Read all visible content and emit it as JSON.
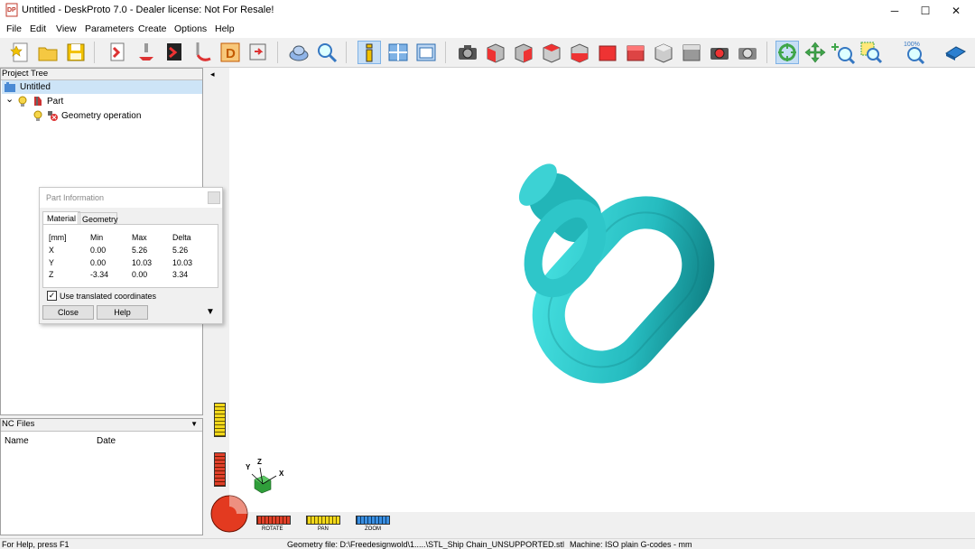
{
  "window": {
    "title": "Untitled - DeskProto 7.0 - Dealer license: Not For Resale!",
    "app_icon_text": "DP",
    "minimize": "─",
    "maximize": "☐",
    "close": "✕"
  },
  "menu": [
    "File",
    "Edit",
    "View",
    "Parameters",
    "Create",
    "Options",
    "Help"
  ],
  "toolbar": {
    "zoom_percent_label": "100%"
  },
  "project_tree": {
    "header": "Project Tree",
    "root": "Untitled",
    "expander": "⌄",
    "part": "Part",
    "geometry_operation": "Geometry operation"
  },
  "nc_files": {
    "header": "NC Files",
    "dropdown": "▼",
    "col_name": "Name",
    "col_date": "Date"
  },
  "viewport": {
    "collapse_arrow": "◂",
    "axis_x": "X",
    "axis_y": "Y",
    "axis_z": "Z",
    "rotate_label": "ROTATE",
    "pan_label": "PAN",
    "zoom_label": "ZOOM",
    "model_color": "#33c9cc"
  },
  "part_info": {
    "title": "Part Information",
    "tabs": [
      "Material",
      "Geometry"
    ],
    "headers": [
      "[mm]",
      "Min",
      "Max",
      "Delta"
    ],
    "rows": [
      [
        "X",
        "0.00",
        "5.26",
        "5.26"
      ],
      [
        "Y",
        "0.00",
        "10.03",
        "10.03"
      ],
      [
        "Z",
        "-3.34",
        "0.00",
        "3.34"
      ]
    ],
    "checkbox_label": "Use translated coordinates",
    "checkbox_checked": true,
    "close_button": "Close",
    "help_button": "Help",
    "expand_arrow": "▼"
  },
  "status": {
    "help": "For Help, press F1",
    "geometry_file": "Geometry file: D:\\Freedesignwold\\1.....\\STL_Ship Chain_UNSUPPORTED.stl",
    "machine": "Machine: ISO plain G-codes - mm"
  }
}
